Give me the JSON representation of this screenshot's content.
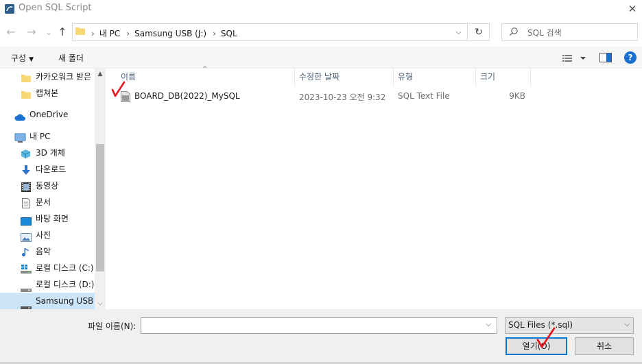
{
  "window": {
    "title": "Open SQL Script",
    "close": "✕"
  },
  "nav": {
    "back": "←",
    "forward": "→",
    "recent": "⌄",
    "up": "↑",
    "breadcrumb": [
      "내 PC",
      "Samsung USB (J:)",
      "SQL"
    ],
    "refresh": "↻",
    "search_placeholder": "SQL 검색"
  },
  "toolbar": {
    "organize": "구성",
    "new_folder": "새 폴더",
    "help": "?"
  },
  "sidebar": {
    "items": [
      {
        "label": "카카오워크 받은",
        "icon": "folder-icon"
      },
      {
        "label": "캡쳐본",
        "icon": "folder-icon"
      },
      {
        "label": "OneDrive",
        "icon": "cloud-icon"
      },
      {
        "label": "내 PC",
        "icon": "pc-icon"
      },
      {
        "label": "3D 개체",
        "icon": "cube-icon"
      },
      {
        "label": "다운로드",
        "icon": "download-icon"
      },
      {
        "label": "동영상",
        "icon": "video-icon"
      },
      {
        "label": "문서",
        "icon": "document-icon"
      },
      {
        "label": "바탕 화면",
        "icon": "desktop-icon"
      },
      {
        "label": "사진",
        "icon": "picture-icon"
      },
      {
        "label": "음악",
        "icon": "music-icon"
      },
      {
        "label": "로컬 디스크 (C:)",
        "icon": "windows-drive-icon"
      },
      {
        "label": "로컬 디스크 (D:)",
        "icon": "drive-icon"
      },
      {
        "label": "Samsung USB (J:)",
        "icon": "usb-drive-icon"
      }
    ]
  },
  "columns": {
    "name": "이름",
    "modified": "수정한 날짜",
    "type": "유형",
    "size": "크기"
  },
  "files": [
    {
      "name": "BOARD_DB(2022)_MySQL",
      "modified": "2023-10-23 오전 9:32",
      "type": "SQL Text File",
      "size": "9KB"
    }
  ],
  "bottom": {
    "filename_label": "파일 이름(N):",
    "filename_value": "",
    "filetype": "SQL Files (*.sql)",
    "open": "열기(O)",
    "cancel": "취소"
  },
  "colors": {
    "accent": "#0078d7",
    "selection": "#cce4f7",
    "folder": "#f8d775",
    "annotation": "#e8141c"
  }
}
